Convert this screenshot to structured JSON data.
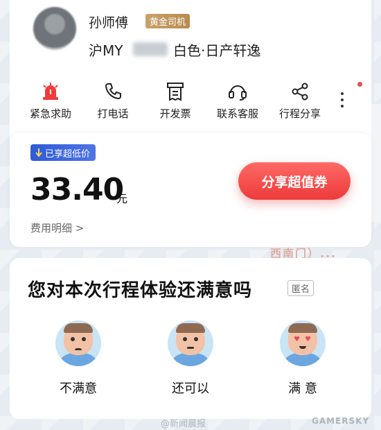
{
  "driver": {
    "name": "孙师傅",
    "badge": "黄金司机",
    "plate_prefix": "沪MY",
    "car_info": "白色·日产轩逸"
  },
  "actions": [
    {
      "label": "紧急求助",
      "icon": "alarm-icon"
    },
    {
      "label": "打电话",
      "icon": "phone-icon"
    },
    {
      "label": "开发票",
      "icon": "invoice-icon"
    },
    {
      "label": "联系客服",
      "icon": "headset-icon"
    },
    {
      "label": "行程分享",
      "icon": "share-icon"
    }
  ],
  "price": {
    "discount_tag": "已享超低价",
    "amount": "33.40",
    "unit": "元",
    "fee_detail": "费用明细 >",
    "share_button": "分享超值券"
  },
  "map": {
    "label": "西南门）..."
  },
  "rating": {
    "question": "您对本次行程体验还满意吗",
    "anonymous": "匿名",
    "options": [
      {
        "label": "不满意",
        "icon": "unsatisfied-face-icon"
      },
      {
        "label": "还可以",
        "icon": "neutral-face-icon"
      },
      {
        "label": "满 意",
        "icon": "satisfied-face-icon"
      }
    ]
  },
  "watermark": {
    "left": "@新闻晨报",
    "right": "GAMERSKY"
  },
  "colors": {
    "accent_red": "#ec3a3a",
    "gold": "#c9a26b",
    "blue_tag": "#2f5bd6"
  }
}
